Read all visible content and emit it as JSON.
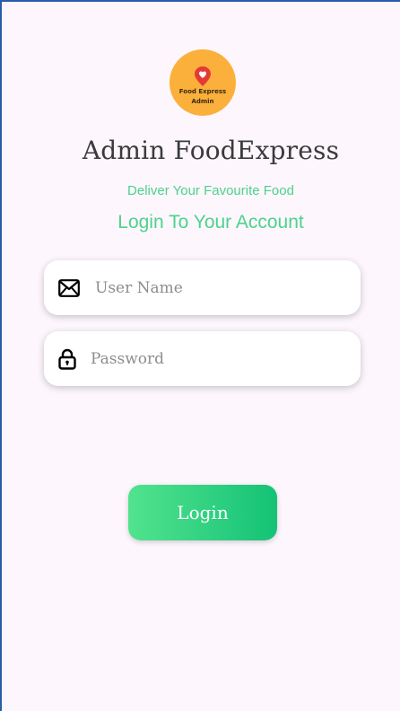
{
  "logo": {
    "line1": "Food Express",
    "line2": "Admin",
    "background": "#fbb03b",
    "pin_color": "#e53935"
  },
  "header": {
    "title": "Admin FoodExpress",
    "tagline": "Deliver Your Favourite Food",
    "login_heading": "Login To Your Account"
  },
  "form": {
    "username": {
      "placeholder": "User Name",
      "value": "",
      "icon": "envelope-icon"
    },
    "password": {
      "placeholder": "Password",
      "value": "",
      "icon": "lock-icon"
    },
    "login_label": "Login"
  },
  "colors": {
    "background": "#fdf6fd",
    "accent_green": "#4cd38a",
    "button_gradient_start": "#52e38e",
    "button_gradient_end": "#14c276"
  }
}
